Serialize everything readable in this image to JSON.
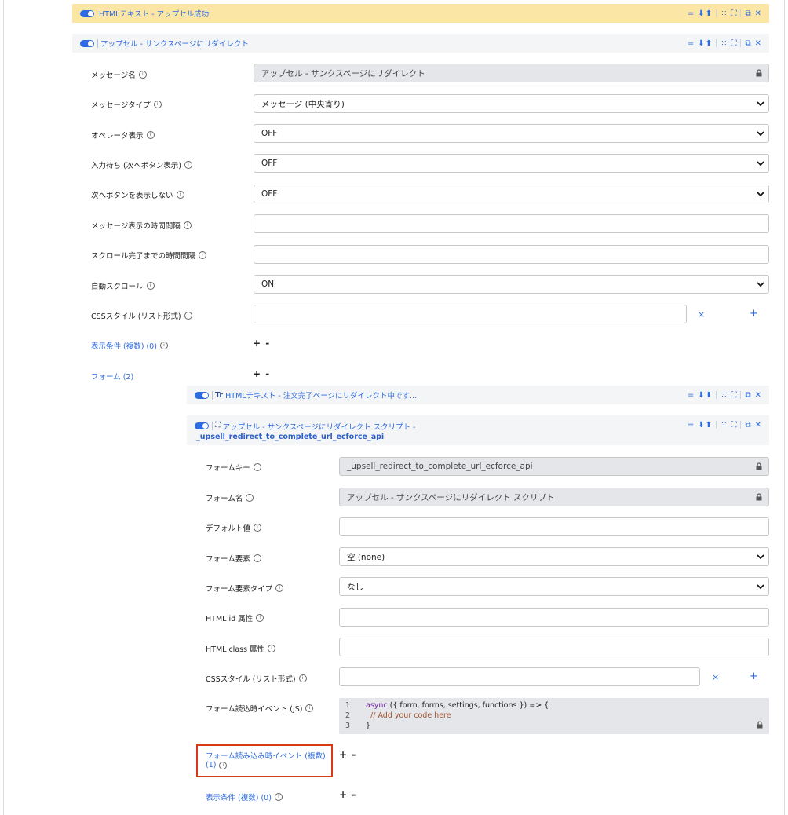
{
  "bars": {
    "top": {
      "title": "HTMLテキスト - アップセル成功"
    },
    "redirect": {
      "title": "アップセル - サンクスページにリダイレクト"
    },
    "html_text": {
      "prefix": "Tr",
      "title": "HTMLテキスト - 注文完了ページにリダイレクト中です..."
    },
    "script": {
      "title": "アップセル - サンクスページにリダイレクト スクリプト -",
      "subtitle": "_upsell_redirect_to_complete_url_ecforce_api"
    }
  },
  "message": {
    "name": {
      "label": "メッセージ名",
      "value": "アップセル - サンクスページにリダイレクト"
    },
    "type": {
      "label": "メッセージタイプ",
      "value": "メッセージ (中央寄り)"
    },
    "operator": {
      "label": "オペレータ表示",
      "value": "OFF"
    },
    "wait_input": {
      "label": "入力待ち (次へボタン表示)",
      "value": "OFF"
    },
    "hide_next": {
      "label": "次へボタンを表示しない",
      "value": "OFF"
    },
    "display_interval": {
      "label": "メッセージ表示の時間間隔",
      "value": ""
    },
    "scroll_interval": {
      "label": "スクロール完了までの時間間隔",
      "value": ""
    },
    "auto_scroll": {
      "label": "自動スクロール",
      "value": "ON"
    },
    "css": {
      "label": "CSSスタイル (リスト形式)",
      "value": ""
    },
    "conditions": {
      "label": "表示条件 (複数) (0)"
    },
    "forms": {
      "label": "フォーム (2)"
    }
  },
  "form": {
    "key": {
      "label": "フォームキー",
      "value": "_upsell_redirect_to_complete_url_ecforce_api"
    },
    "name": {
      "label": "フォーム名",
      "value": "アップセル - サンクスページにリダイレクト スクリプト"
    },
    "default": {
      "label": "デフォルト値",
      "value": ""
    },
    "element": {
      "label": "フォーム要素",
      "value": "空 (none)"
    },
    "element_type": {
      "label": "フォーム要素タイプ",
      "value": "なし"
    },
    "html_id": {
      "label": "HTML id 属性",
      "value": ""
    },
    "html_class": {
      "label": "HTML class 属性",
      "value": ""
    },
    "css": {
      "label": "CSSスタイル (リスト形式)",
      "value": ""
    },
    "on_load": {
      "label": "フォーム読込時イベント (JS)",
      "lines": [
        {
          "no": "1",
          "kw": "async",
          "text": " ({ form, forms, settings, functions }) => {"
        },
        {
          "no": "2",
          "kw": "",
          "text": "  // Add your code here"
        },
        {
          "no": "3",
          "kw": "",
          "text": "}"
        }
      ]
    },
    "load_events": {
      "label_line1": "フォーム読み込み時イベント (複数)",
      "label_line2": "(1)"
    },
    "conditions": {
      "label": "表示条件 (複数) (0)"
    }
  },
  "buttons": {
    "remove": "×",
    "add": "+",
    "plus_minus": "+ -"
  },
  "colors": {
    "accent": "#2d6be0",
    "highlight": "#d93a16",
    "yellow_bar": "#fbe6a6"
  }
}
